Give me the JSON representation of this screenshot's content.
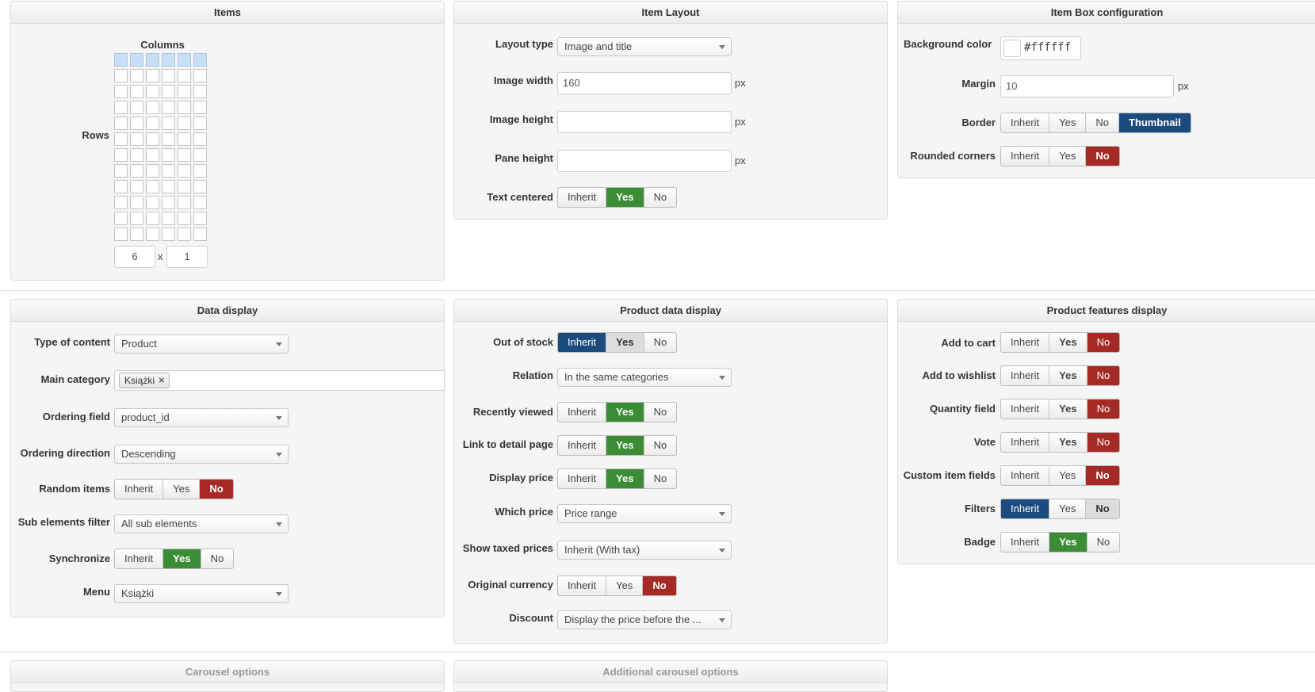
{
  "items_panel": {
    "title": "Items",
    "columns_label": "Columns",
    "rows_label": "Rows",
    "grid": {
      "columns": 6,
      "rows": 12,
      "selected_columns": 6,
      "selected_rows": 1
    },
    "cols_value": "6",
    "times": "x",
    "rows_value": "1"
  },
  "item_layout": {
    "title": "Item Layout",
    "layout_type_label": "Layout type",
    "layout_type_value": "Image and title",
    "image_width_label": "Image width",
    "image_width_value": "160",
    "image_height_label": "Image height",
    "image_height_value": "",
    "pane_height_label": "Pane height",
    "pane_height_value": "",
    "px": "px",
    "text_centered_label": "Text centered",
    "text_centered_options": [
      "Inherit",
      "Yes",
      "No"
    ],
    "text_centered_selected": "Yes"
  },
  "item_box": {
    "title": "Item Box configuration",
    "bg_color_label": "Background color",
    "bg_color_value": "#ffffff",
    "margin_label": "Margin",
    "margin_value": "10",
    "px": "px",
    "border_label": "Border",
    "border_options": [
      "Inherit",
      "Yes",
      "No",
      "Thumbnail"
    ],
    "border_selected": "Thumbnail",
    "rounded_label": "Rounded corners",
    "rounded_options": [
      "Inherit",
      "Yes",
      "No"
    ],
    "rounded_selected": "No"
  },
  "data_display": {
    "title": "Data display",
    "type_label": "Type of content",
    "type_value": "Product",
    "main_category_label": "Main category",
    "main_category_tag": "Książki",
    "ordering_field_label": "Ordering field",
    "ordering_field_value": "product_id",
    "ordering_direction_label": "Ordering direction",
    "ordering_direction_value": "Descending",
    "random_items_label": "Random items",
    "random_items_options": [
      "Inherit",
      "Yes",
      "No"
    ],
    "random_items_selected": "No",
    "sub_elements_label": "Sub elements filter",
    "sub_elements_value": "All sub elements",
    "synchronize_label": "Synchronize",
    "synchronize_options": [
      "Inherit",
      "Yes",
      "No"
    ],
    "synchronize_selected": "Yes",
    "menu_label": "Menu",
    "menu_value": "Książki"
  },
  "product_data": {
    "title": "Product data display",
    "out_of_stock_label": "Out of stock",
    "out_of_stock_options": [
      "Inherit",
      "Yes",
      "No"
    ],
    "relation_label": "Relation",
    "relation_value": "In the same categories",
    "recently_viewed_label": "Recently viewed",
    "link_detail_label": "Link to detail page",
    "display_price_label": "Display price",
    "which_price_label": "Which price",
    "which_price_value": "Price range",
    "show_taxed_label": "Show taxed prices",
    "show_taxed_value": "Inherit (With tax)",
    "original_currency_label": "Original currency",
    "discount_label": "Discount",
    "discount_value": "Display the price before the ...",
    "yn_options": [
      "Inherit",
      "Yes",
      "No"
    ]
  },
  "features": {
    "title": "Product features display",
    "add_to_cart_label": "Add to cart",
    "add_to_wishlist_label": "Add to wishlist",
    "quantity_field_label": "Quantity field",
    "vote_label": "Vote",
    "custom_fields_label": "Custom item fields",
    "filters_label": "Filters",
    "badge_label": "Badge",
    "yn_options": [
      "Inherit",
      "Yes",
      "No"
    ]
  },
  "carousel": {
    "title": "Carousel options"
  },
  "additional_carousel": {
    "title": "Additional carousel options"
  },
  "colors": {
    "green": "#3b8d35",
    "red": "#a52a25",
    "blue": "#1c4b80"
  }
}
